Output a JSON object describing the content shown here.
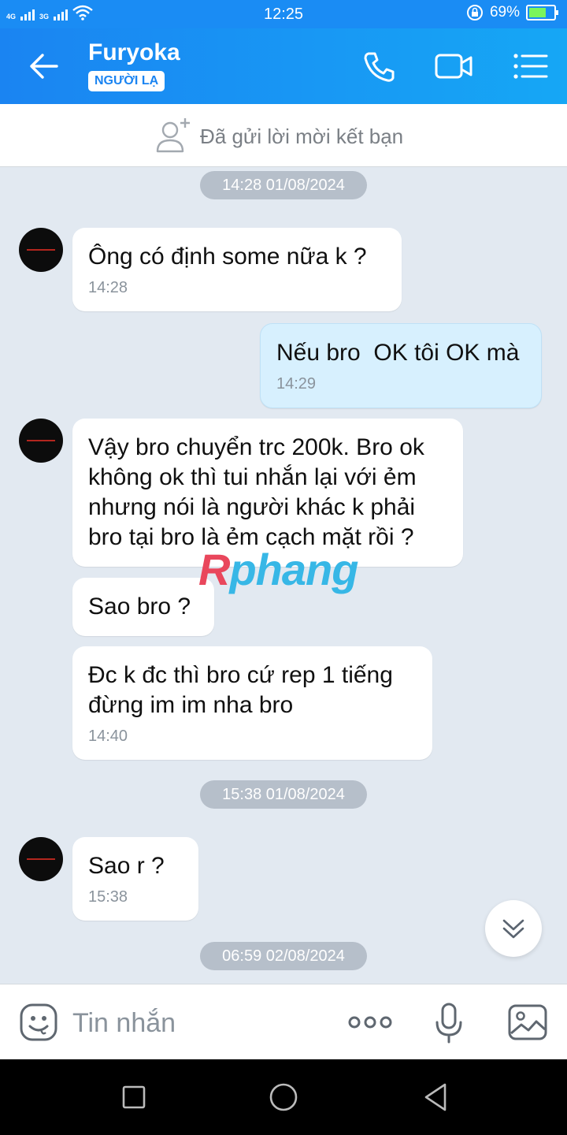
{
  "status_bar": {
    "net1": "4G",
    "net2": "3G",
    "time": "12:25",
    "battery": "69%",
    "battery_level": 0.69
  },
  "header": {
    "name": "Furyoka",
    "badge": "NGƯỜI LẠ"
  },
  "invite_banner": {
    "text": "Đã gửi lời mời kết bạn"
  },
  "date_separators": [
    "14:28 01/08/2024",
    "15:38 01/08/2024",
    "06:59 02/08/2024"
  ],
  "messages": [
    {
      "text": "Ông có định some nữa k ?",
      "time": "14:28"
    },
    {
      "text": "Nếu bro  OK tôi OK mà",
      "time": "14:29"
    },
    {
      "text": "Vậy bro chuyển trc 200k. Bro ok không ok thì tui nhắn lại với ẻm nhưng nói là người khác k phải bro tại bro là ẻm cạch mặt rồi ?",
      "time": ""
    },
    {
      "text": "Sao bro ?",
      "time": ""
    },
    {
      "text": "Đc k đc thì bro cứ rep 1 tiếng đừng im im nha bro",
      "time": "14:40"
    },
    {
      "text": "Sao r ?",
      "time": "15:38"
    }
  ],
  "watermark": {
    "a": "R",
    "b": "phang"
  },
  "input": {
    "placeholder": "Tin nhắn"
  },
  "icons": {
    "back": "back-arrow-icon",
    "call": "phone-icon",
    "video": "video-camera-icon",
    "menu": "menu-icon",
    "add_friend": "add-user-icon",
    "scroll": "double-chevron-down-icon",
    "emoji": "emoji-icon",
    "more": "more-dots-icon",
    "mic": "microphone-icon",
    "image": "image-icon"
  },
  "colors": {
    "header": "#1a84f2",
    "my_bubble": "#d7f0fe",
    "background": "#e2e9f1"
  }
}
